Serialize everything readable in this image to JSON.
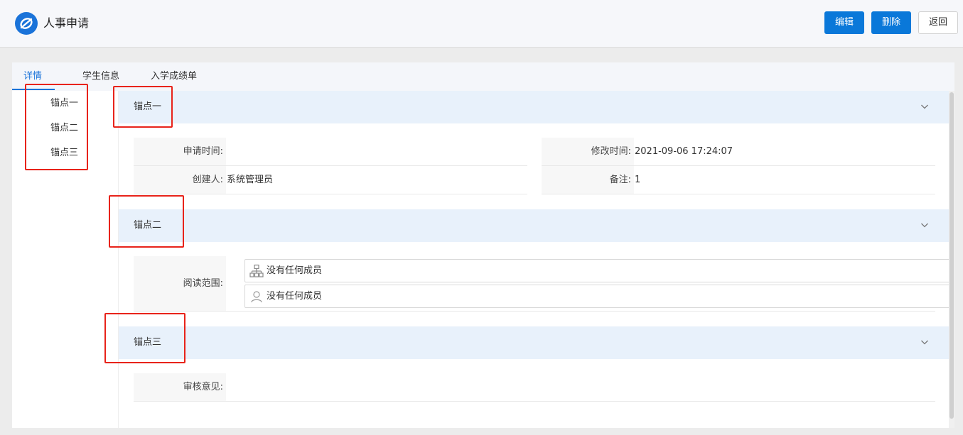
{
  "header": {
    "title": "人事申请",
    "logo_icon": "app-logo-icon",
    "buttons": {
      "edit": "编辑",
      "delete": "删除",
      "back": "返回"
    }
  },
  "tabs": [
    {
      "label": "详情",
      "active": true
    },
    {
      "label": "学生信息",
      "active": false
    },
    {
      "label": "入学成绩单",
      "active": false
    }
  ],
  "anchor_nav": {
    "items": [
      "锚点一",
      "锚点二",
      "锚点三"
    ]
  },
  "sections": {
    "anchor1": {
      "title": "锚点一",
      "fields": {
        "apply_time": {
          "label": "申请时间:",
          "value": ""
        },
        "modify_time": {
          "label": "修改时间:",
          "value": "2021-09-06 17:24:07"
        },
        "creator": {
          "label": "创建人:",
          "value": "系统管理员"
        },
        "remark": {
          "label": "备注:",
          "value": "1"
        }
      }
    },
    "anchor2": {
      "title": "锚点二",
      "read_scope": {
        "label": "阅读范围:",
        "org_text": "没有任何成员",
        "user_text": "没有任何成员"
      }
    },
    "anchor3": {
      "title": "锚点三",
      "review": {
        "label": "审核意见:",
        "value": ""
      }
    }
  },
  "colors": {
    "primary": "#0a78d9",
    "section_bg": "#e8f1fb",
    "highlight": "#e8231a"
  }
}
